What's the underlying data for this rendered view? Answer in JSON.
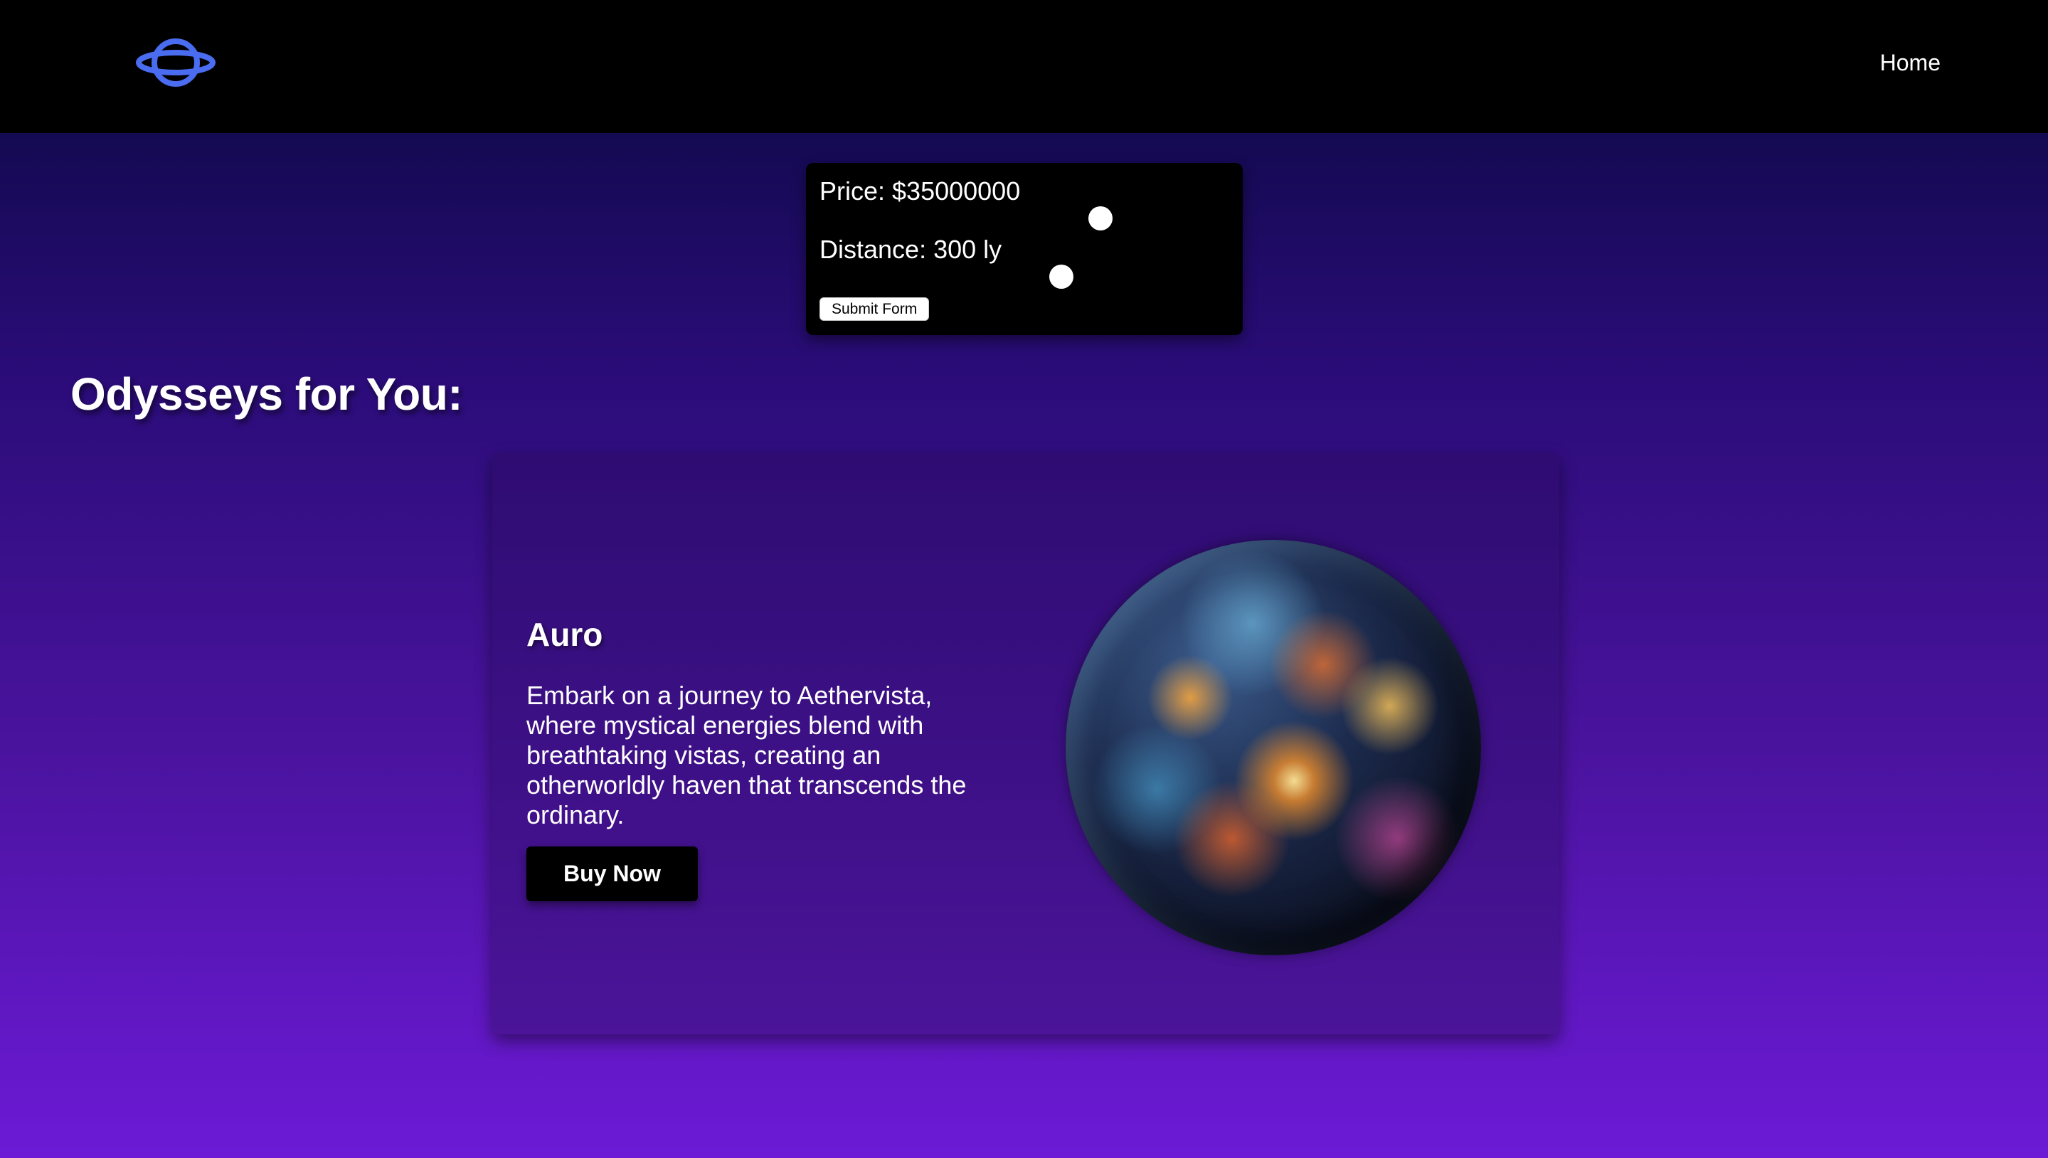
{
  "nav": {
    "logo_icon": "planet-ring-icon",
    "home_label": "Home"
  },
  "filters": {
    "price_label": "Price: $35000000",
    "price_value": 35000000,
    "distance_label": "Distance: 300 ly",
    "distance_value": 300,
    "submit_label": "Submit Form"
  },
  "section": {
    "title": "Odysseys for You:"
  },
  "cards": [
    {
      "title": "Auro",
      "description": "Embark on a journey to Aethervista, where mystical energies blend with breathtaking vistas, creating an otherworldly haven that transcends the ordinary.",
      "button_label": "Buy Now",
      "image": "planet-image"
    }
  ],
  "colors": {
    "accent_logo": "#4a6cf0",
    "nav_bg": "#000000",
    "bg_top": "#140a52",
    "bg_bottom": "#6c1ad6"
  }
}
